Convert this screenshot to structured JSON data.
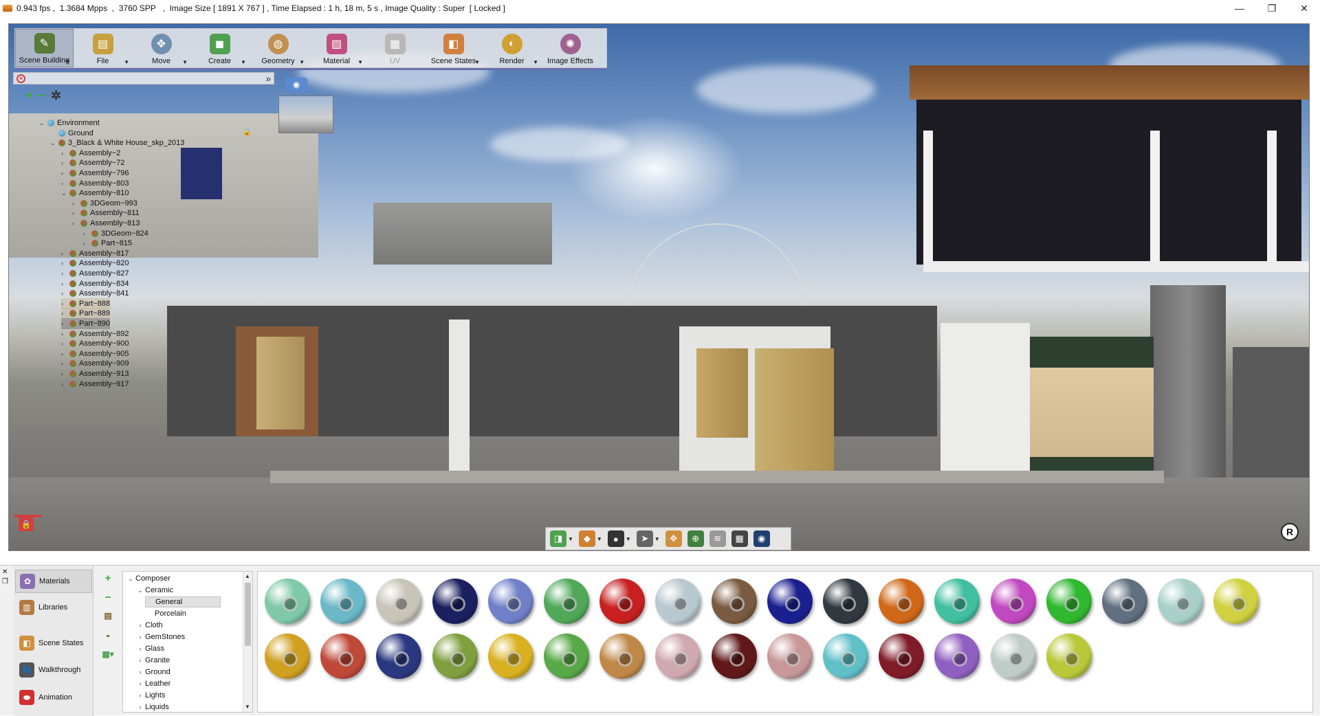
{
  "titlebar": {
    "status": "0.943 fps ,  1.3684 Mpps  ,  3760 SPP   ,  Image Size [ 1891 X 767 ] , Time Elapsed : 1 h, 18 m, 5 s , Image Quality : Super  [ Locked ]",
    "minimize": "—",
    "restore": "❐",
    "close": "✕"
  },
  "toolbar": {
    "items": [
      {
        "label": "Scene Building",
        "icon": "scene-building-icon",
        "color": "#5a7a3a"
      },
      {
        "label": "File",
        "icon": "file-icon",
        "color": "#c8a040"
      },
      {
        "label": "Move",
        "icon": "move-icon",
        "color": "#7090b0"
      },
      {
        "label": "Create",
        "icon": "create-icon",
        "color": "#50a050"
      },
      {
        "label": "Geometry",
        "icon": "geometry-icon",
        "color": "#c09050"
      },
      {
        "label": "Material",
        "icon": "material-icon",
        "color": "#c05080"
      },
      {
        "label": "UV",
        "icon": "uv-icon",
        "color": "#a0a0a0"
      },
      {
        "label": "Scene States",
        "icon": "scene-states-icon",
        "color": "#d08040"
      },
      {
        "label": "Render",
        "icon": "render-icon",
        "color": "#d0a030"
      },
      {
        "label": "Image Effects",
        "icon": "image-effects-icon",
        "color": "#a06090"
      }
    ]
  },
  "scene_tree": {
    "rows": [
      {
        "label": "Environment",
        "indent": 0
      },
      {
        "label": "Ground",
        "indent": 1
      },
      {
        "label": "3_Black & White House_skp_2013",
        "indent": 1
      },
      {
        "label": "Assembly~2",
        "indent": 2
      },
      {
        "label": "Assembly~72",
        "indent": 2
      },
      {
        "label": "Assembly~796",
        "indent": 2
      },
      {
        "label": "Assembly~803",
        "indent": 2
      },
      {
        "label": "Assembly~810",
        "indent": 2
      },
      {
        "label": "3DGeom~993",
        "indent": 3
      },
      {
        "label": "Assembly~811",
        "indent": 3
      },
      {
        "label": "Assembly~813",
        "indent": 3
      },
      {
        "label": "3DGeom~824",
        "indent": 4
      },
      {
        "label": "Part~815",
        "indent": 4
      },
      {
        "label": "Assembly~817",
        "indent": 2
      },
      {
        "label": "Assembly~820",
        "indent": 2
      },
      {
        "label": "Assembly~827",
        "indent": 2
      },
      {
        "label": "Assembly~834",
        "indent": 2
      },
      {
        "label": "Assembly~841",
        "indent": 2
      },
      {
        "label": "Part~888",
        "indent": 2
      },
      {
        "label": "Part~889",
        "indent": 2
      },
      {
        "label": "Part~890",
        "indent": 2
      },
      {
        "label": "Assembly~892",
        "indent": 2
      },
      {
        "label": "Assembly~900",
        "indent": 2
      },
      {
        "label": "Assembly~905",
        "indent": 2
      },
      {
        "label": "Assembly~909",
        "indent": 2
      },
      {
        "label": "Assembly~913",
        "indent": 2
      },
      {
        "label": "Assembly~917",
        "indent": 2
      }
    ]
  },
  "tabs": [
    {
      "label": "Materials",
      "icon": "materials-icon",
      "color": "#8a70b0"
    },
    {
      "label": "Libraries",
      "icon": "libraries-icon",
      "color": "#b07a40"
    },
    {
      "label": "Scene States",
      "icon": "scene-states-tab-icon",
      "color": "#d09040"
    },
    {
      "label": "Walkthrough",
      "icon": "footsteps-icon",
      "color": "#555555"
    },
    {
      "label": "Animation",
      "icon": "animation-icon",
      "color": "#d03030"
    }
  ],
  "library_tree": {
    "rows": [
      {
        "label": "Composer",
        "indent": 0,
        "expander": "⌄"
      },
      {
        "label": "Ceramic",
        "indent": 1,
        "expander": "⌄"
      },
      {
        "label": "General",
        "indent": 2,
        "expander": ""
      },
      {
        "label": "Porcelain",
        "indent": 2,
        "expander": ""
      },
      {
        "label": "Cloth",
        "indent": 1,
        "expander": "›"
      },
      {
        "label": "GemStones",
        "indent": 1,
        "expander": "›"
      },
      {
        "label": "Glass",
        "indent": 1,
        "expander": "›"
      },
      {
        "label": "Granite",
        "indent": 1,
        "expander": "›"
      },
      {
        "label": "Ground",
        "indent": 1,
        "expander": "›"
      },
      {
        "label": "Leather",
        "indent": 1,
        "expander": "›"
      },
      {
        "label": "Lights",
        "indent": 1,
        "expander": "›"
      },
      {
        "label": "Liquids",
        "indent": 1,
        "expander": "›"
      }
    ]
  },
  "materials": {
    "row1": [
      "#7fc8a8",
      "#6ab8c8",
      "#c8c4b8",
      "#1a2060",
      "#7080c8",
      "#50a858",
      "#c82020",
      "#b8c8d0",
      "#7a5a40",
      "#1a2090",
      "#303840",
      "#d06818",
      "#40c0a0",
      "#c048c0",
      "#30b830",
      "#607080",
      "#a8d0c8",
      "#d0d040"
    ],
    "row2": [
      "#d0a020",
      "#c04838",
      "#2a3880",
      "#80a040",
      "#d8b020",
      "#58a848",
      "#c08848",
      "#d0a8b0",
      "#601818",
      "#c89898",
      "#60c0c8",
      "#801c28",
      "#9060c0",
      "#c0ccc8",
      "#b8c838"
    ]
  },
  "viewport_tools": [
    {
      "icon": "view-cube-icon",
      "color": "#50a050"
    },
    {
      "icon": "layer-icon",
      "color": "#d08030"
    },
    {
      "icon": "render-mode-icon",
      "color": "#333333"
    },
    {
      "icon": "select-icon",
      "color": "#666666"
    },
    {
      "icon": "grid-move-icon",
      "color": "#d09040"
    },
    {
      "icon": "zoom-icon",
      "color": "#408040"
    },
    {
      "icon": "wifi-icon",
      "color": "#999999"
    },
    {
      "icon": "chip-icon",
      "color": "#444444"
    },
    {
      "icon": "camera-icon",
      "color": "#204070"
    }
  ]
}
